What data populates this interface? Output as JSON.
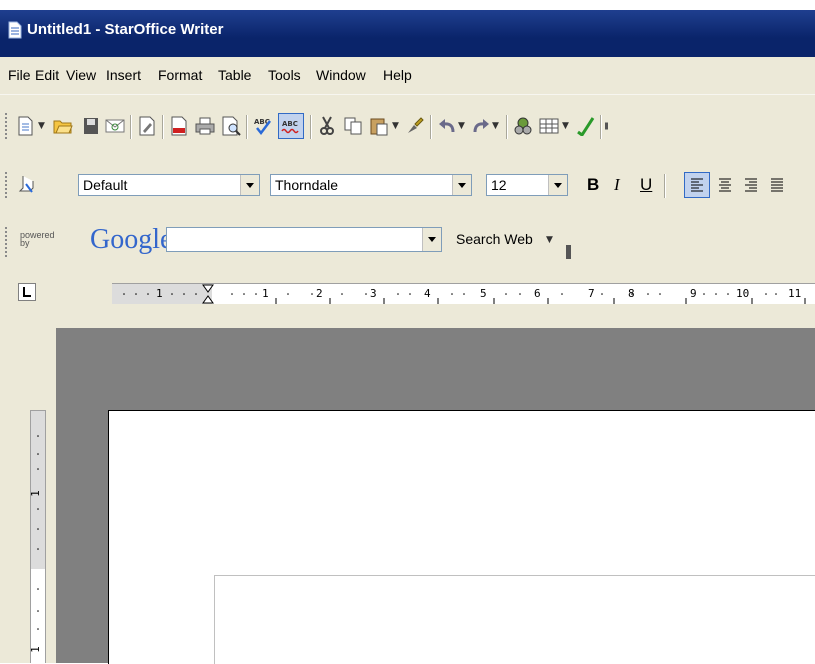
{
  "window": {
    "title": "Untitled1 - StarOffice Writer"
  },
  "menubar": {
    "items": [
      "File",
      "Edit",
      "View",
      "Insert",
      "Format",
      "Table",
      "Tools",
      "Window",
      "Help"
    ]
  },
  "standard_toolbar": {
    "icons": [
      "new-document-icon",
      "open-icon",
      "save-icon",
      "email-icon",
      "edit-file-icon",
      "export-pdf-icon",
      "print-icon",
      "page-preview-icon",
      "spellcheck-icon",
      "autospellcheck-icon",
      "cut-icon",
      "copy-icon",
      "paste-icon",
      "clone-formatting-icon",
      "undo-icon",
      "redo-icon",
      "navigator-icon",
      "table-icon",
      "draw-functions-icon",
      "find-icon"
    ]
  },
  "formatting_toolbar": {
    "style": "Default",
    "font_name": "Thorndale",
    "font_size": "12",
    "bold_label": "B",
    "italic_label": "I",
    "underline_label": "U"
  },
  "google_toolbar": {
    "powered_by": "powered by",
    "brand": "Google",
    "search_value": "",
    "search_button": "Search Web"
  },
  "ruler": {
    "labels": [
      "1",
      "1",
      "2",
      "3",
      "4",
      "5",
      "6",
      "7",
      "8",
      "9",
      "10",
      "11"
    ]
  },
  "vertical_ruler": {
    "labels": [
      "1",
      "1"
    ]
  },
  "colors": {
    "titlebar": "#0a246a",
    "chrome": "#ece9d8",
    "canvas": "#808080",
    "google_blue": "#3366cc",
    "google_red": "#cc3333"
  }
}
